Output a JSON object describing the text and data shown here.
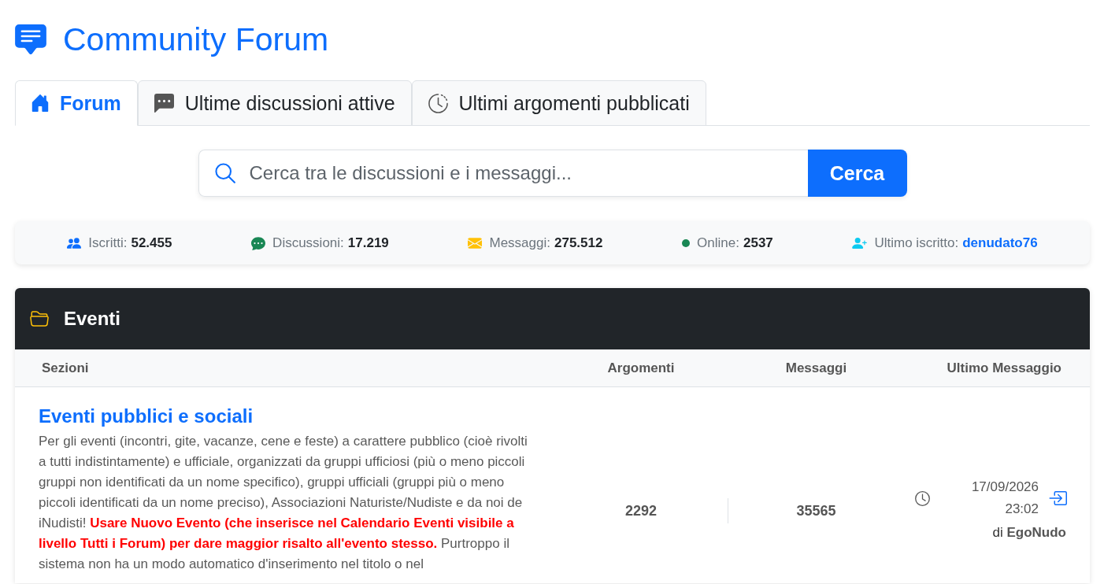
{
  "header": {
    "title": "Community Forum"
  },
  "tabs": [
    {
      "kind": "home",
      "label": "Forum",
      "selected": true
    },
    {
      "kind": "chat",
      "label": "Ultime discussioni attive",
      "selected": false
    },
    {
      "kind": "history",
      "label": "Ultimi argomenti pubblicati",
      "selected": false
    }
  ],
  "search": {
    "placeholder": "Cerca tra le discussioni e i messaggi...",
    "button": "Cerca"
  },
  "stats": [
    {
      "kind": "members",
      "label": "Iscritti:",
      "value": "52.455"
    },
    {
      "kind": "discussions",
      "label": "Discussioni:",
      "value": "17.219"
    },
    {
      "kind": "messages",
      "label": "Messaggi:",
      "value": "275.512"
    },
    {
      "kind": "online",
      "label": "Online:",
      "value": "2537"
    },
    {
      "kind": "newest",
      "label": "Ultimo iscritto:",
      "value": "denudato76"
    }
  ],
  "category": {
    "title": "Eventi",
    "columns": [
      "Sezioni",
      "Argomenti",
      "Messaggi",
      "Ultimo Messaggio"
    ],
    "forums": [
      {
        "title": "Eventi pubblici e sociali",
        "description": "Per gli eventi (incontri, gite, vacanze, cene e feste) a carattere pubblico (cioè rivolti a tutti indistintamente) e ufficiale, organizzati da gruppi ufficiosi (più o meno piccoli gruppi non identificati da un nome specifico), gruppi ufficiali (gruppi più o meno piccoli identificati da un nome preciso), Associazioni Naturiste/Nudiste e da noi de iNudisti! **Usare Nuovo Evento (che inserisce nel Calendario Eventi visibile a livello Tutti i Forum) per dare maggior risalto all'evento stesso.** Purtroppo il sistema non ha un modo automatico d'inserimento nel titolo o nel",
        "topics": "2292",
        "posts": "35565",
        "last_post": {
          "date": "17/09/2026",
          "time": "23:02",
          "by_line": "di **EgoNudo**"
        }
      }
    ]
  }
}
